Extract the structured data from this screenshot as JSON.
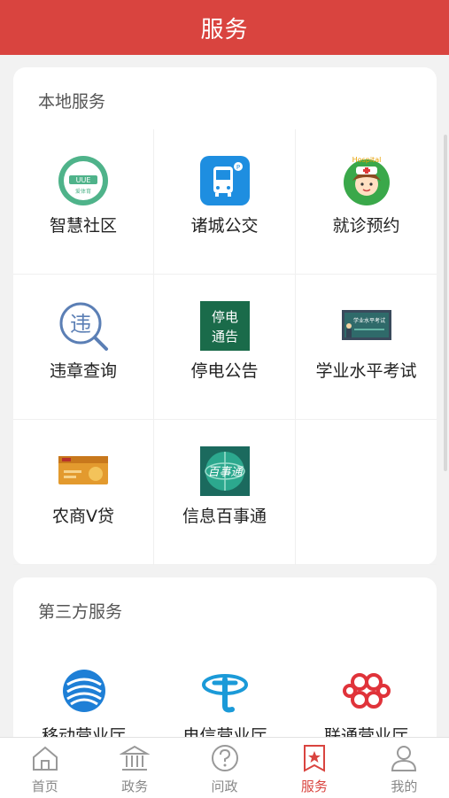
{
  "header": {
    "title": "服务"
  },
  "local_services": {
    "title": "本地服务",
    "items": [
      {
        "label": "智慧社区",
        "icon": "smart-community-icon"
      },
      {
        "label": "诸城公交",
        "icon": "bus-icon"
      },
      {
        "label": "就诊预约",
        "icon": "nurse-icon"
      },
      {
        "label": "违章查询",
        "icon": "violation-search-icon"
      },
      {
        "label": "停电公告",
        "icon": "power-outage-icon"
      },
      {
        "label": "学业水平考试",
        "icon": "exam-blackboard-icon"
      },
      {
        "label": "农商V贷",
        "icon": "loan-card-icon"
      },
      {
        "label": "信息百事通",
        "icon": "info-globe-icon"
      }
    ],
    "icon_texts": {
      "community_badge": "UUE",
      "community_sub": "爱体育",
      "outage_line1": "停电",
      "outage_line2": "通告",
      "violation_char": "违",
      "baishitong": "百事通",
      "exam_board": "学业水平考试",
      "nurse_cap": "Hospital"
    }
  },
  "third_party_services": {
    "title": "第三方服务",
    "items": [
      {
        "label": "移动营业厅",
        "icon": "china-mobile-icon"
      },
      {
        "label": "电信营业厅",
        "icon": "china-telecom-icon"
      },
      {
        "label": "联通营业厅",
        "icon": "china-unicom-icon"
      }
    ]
  },
  "tabbar": {
    "tabs": [
      {
        "label": "首页",
        "icon": "home-icon",
        "active": false
      },
      {
        "label": "政务",
        "icon": "government-icon",
        "active": false
      },
      {
        "label": "问政",
        "icon": "question-icon",
        "active": false
      },
      {
        "label": "服务",
        "icon": "service-star-icon",
        "active": true
      },
      {
        "label": "我的",
        "icon": "user-icon",
        "active": false
      }
    ]
  },
  "colors": {
    "brand": "#d9443f",
    "tab_inactive": "#888888"
  }
}
